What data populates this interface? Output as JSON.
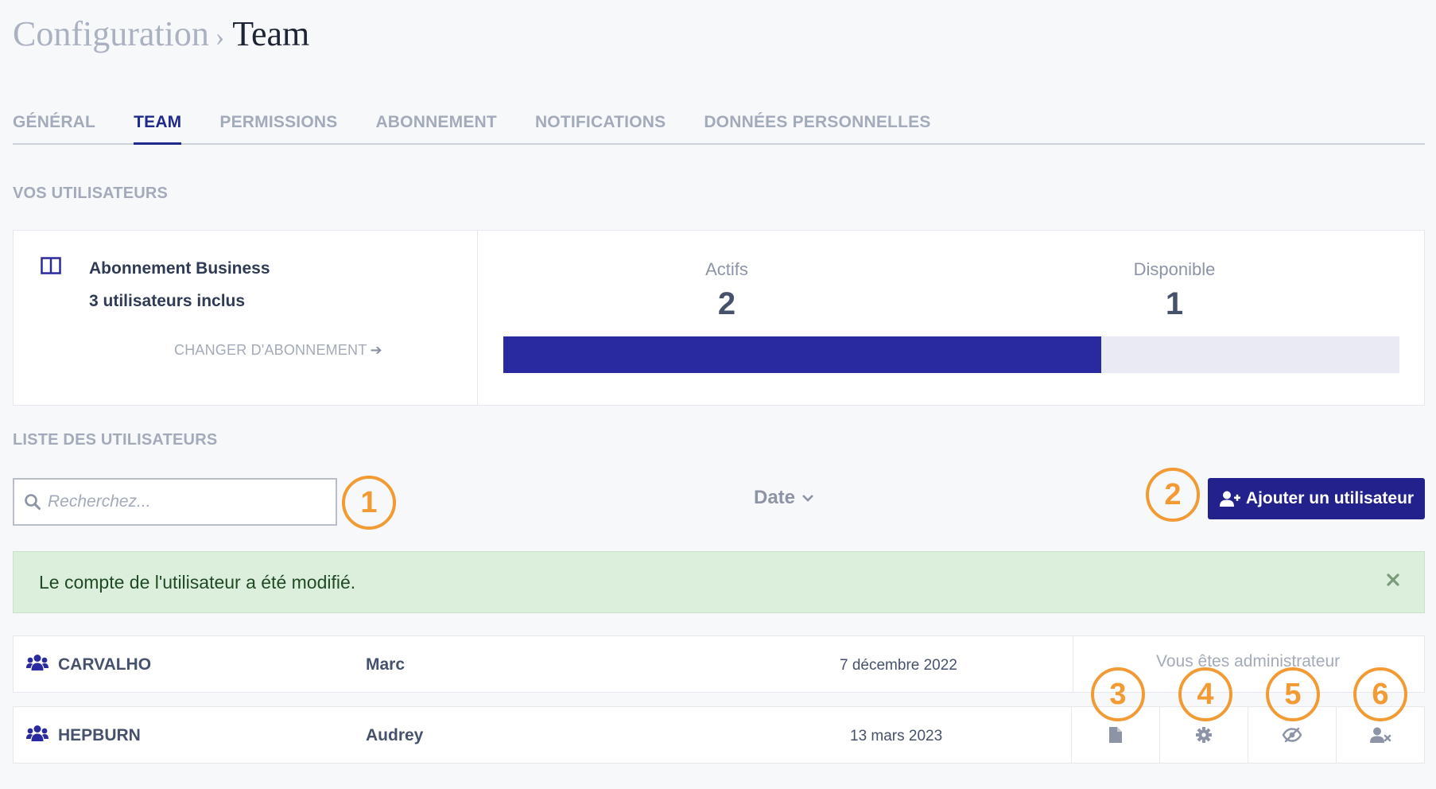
{
  "breadcrumb": {
    "parent": "Configuration",
    "separator": "›",
    "current": "Team"
  },
  "tabs": [
    {
      "label": "GÉNÉRAL",
      "active": false
    },
    {
      "label": "TEAM",
      "active": true
    },
    {
      "label": "PERMISSIONS",
      "active": false
    },
    {
      "label": "ABONNEMENT",
      "active": false
    },
    {
      "label": "NOTIFICATIONS",
      "active": false
    },
    {
      "label": "DONNÉES PERSONNELLES",
      "active": false
    }
  ],
  "users_section": {
    "title": "VOS UTILISATEURS"
  },
  "subscription": {
    "plan": "Abonnement Business",
    "included": "3 utilisateurs inclus",
    "change_link": "CHANGER D'ABONNEMENT",
    "active_label": "Actifs",
    "active_count": "2",
    "available_label": "Disponible",
    "available_count": "1",
    "usage_fraction": 0.667
  },
  "list_section": {
    "title": "LISTE DES UTILISATEURS"
  },
  "search": {
    "placeholder": "Recherchez...",
    "value": ""
  },
  "sort": {
    "label": "Date"
  },
  "add_button": {
    "label": "Ajouter un utilisateur"
  },
  "alert": {
    "message": "Le compte de l'utilisateur a été modifié.",
    "type": "success"
  },
  "users": [
    {
      "last_name": "CARVALHO",
      "first_name": "Marc",
      "date": "7 décembre 2022",
      "note": "Vous êtes administrateur"
    },
    {
      "last_name": "HEPBURN",
      "first_name": "Audrey",
      "date": "13 mars 2023",
      "actions": [
        "document-icon",
        "gear-icon",
        "eye-slash-icon",
        "user-remove-icon"
      ]
    }
  ],
  "callouts": [
    "1",
    "2",
    "3",
    "4",
    "5",
    "6"
  ],
  "colors": {
    "primary": "#23218c",
    "accent_callout": "#f29b35",
    "success_bg": "#dcefdc"
  }
}
